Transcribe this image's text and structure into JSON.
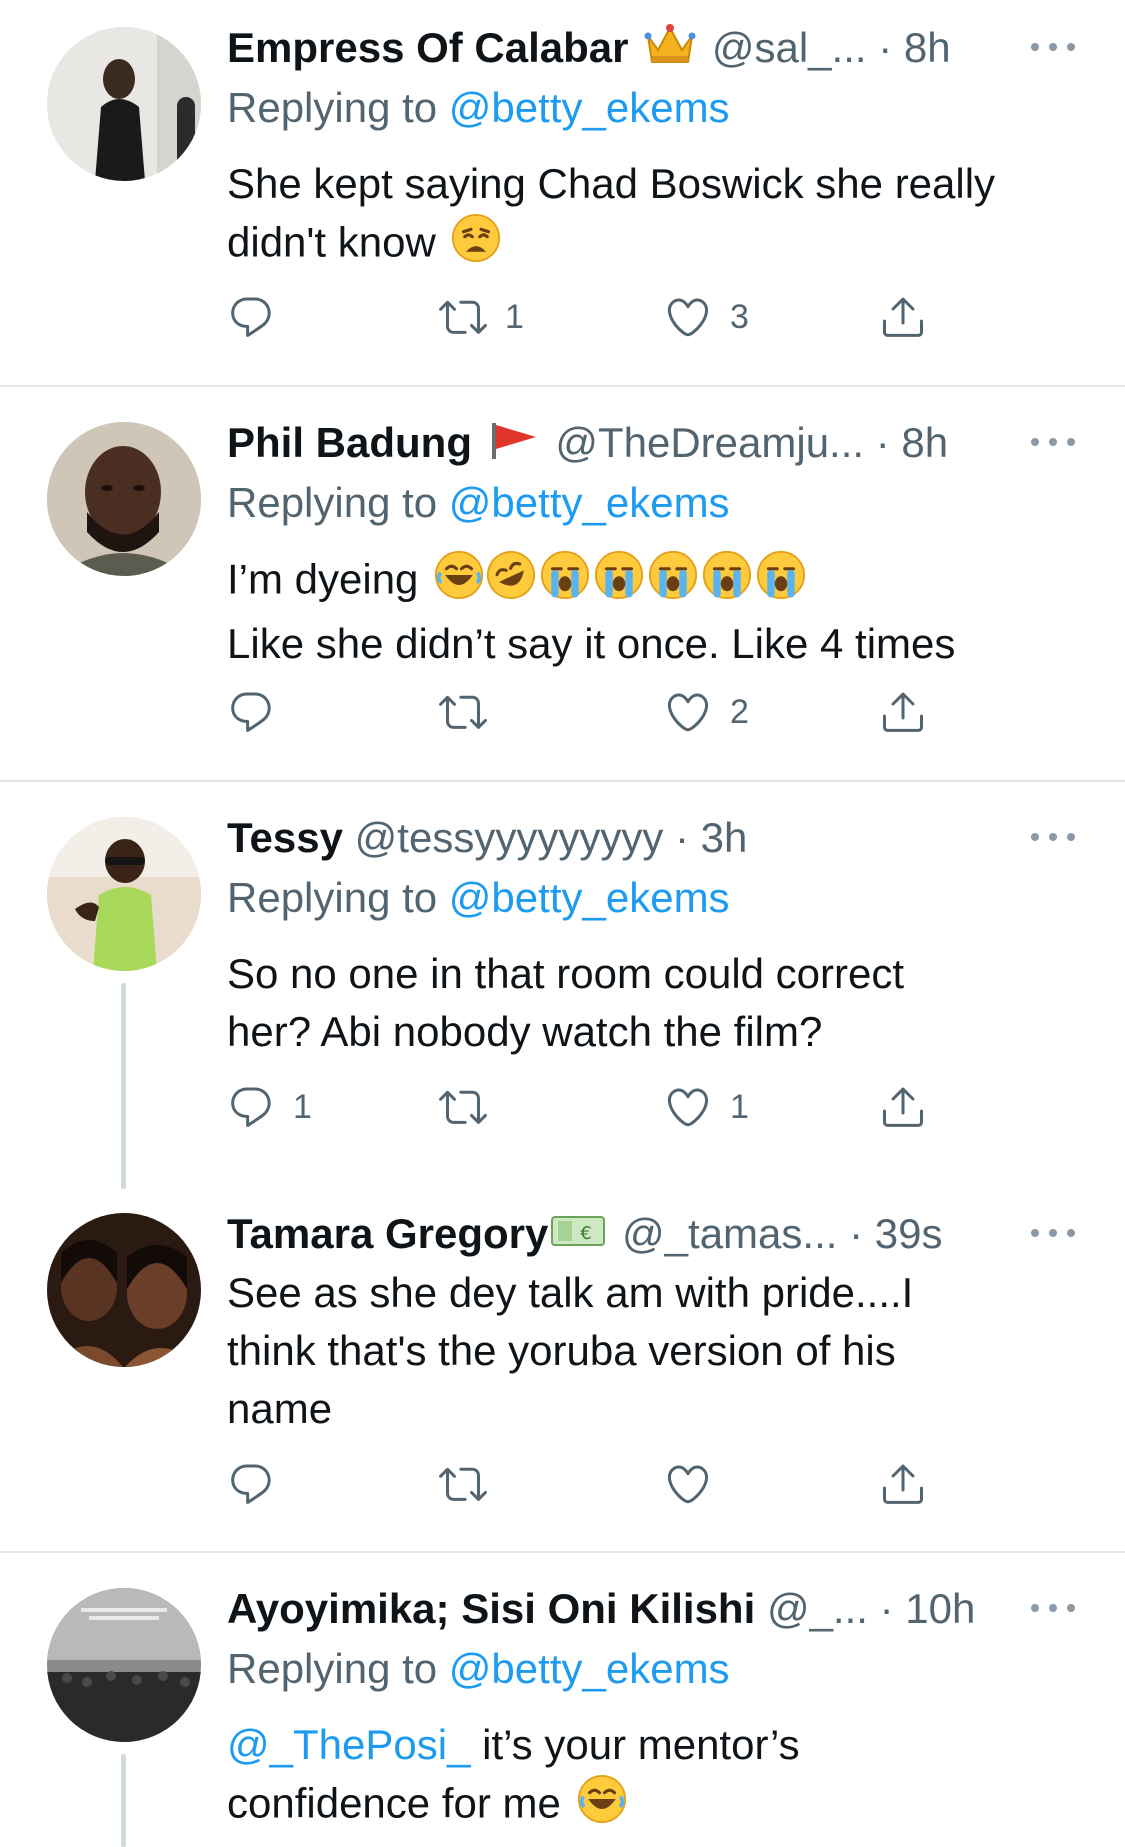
{
  "tweets": [
    {
      "name": "Empress Of Calabar",
      "badge": "crown",
      "handle": "@sal_...",
      "dot": "·",
      "time": "8h",
      "replying_label": "Replying to",
      "replying_handle": "@betty_ekems",
      "text_1": "She kept saying Chad Boswick she really",
      "text_2": "didn't know",
      "reply_count": "",
      "retweet_count": "1",
      "like_count": "3"
    },
    {
      "name": "Phil Badung",
      "badge": "red-flag",
      "handle": "@TheDreamju...",
      "dot": "·",
      "time": "8h",
      "replying_label": "Replying to",
      "replying_handle": "@betty_ekems",
      "text_1": "I’m dyeing",
      "text_2": "Like she didn’t say it once. Like 4 times",
      "reply_count": "",
      "retweet_count": "",
      "like_count": "2"
    },
    {
      "name": "Tessy",
      "handle": "@tessyyyyyyyyy",
      "dot": "·",
      "time": "3h",
      "replying_label": "Replying to",
      "replying_handle": "@betty_ekems",
      "text_1": "So no one in that room could correct",
      "text_2": "her? Abi nobody watch the film?",
      "reply_count": "1",
      "retweet_count": "",
      "like_count": "1"
    },
    {
      "name": "Tamara Gregory",
      "badge": "euro-banknote",
      "handle": "@_tamas...",
      "dot": "·",
      "time": "39s",
      "text_1": "See as she dey talk am with pride....I",
      "text_2": "think that's the yoruba version of his",
      "text_3": "name",
      "reply_count": "",
      "retweet_count": "",
      "like_count": ""
    },
    {
      "name": "Ayoyimika; Sisi Oni Kilishi",
      "handle": "@_...",
      "dot": "·",
      "time": "10h",
      "replying_label": "Replying to",
      "replying_handle": "@betty_ekems",
      "mention": "@_ThePosi_",
      "text_1": " it’s your mentor’s",
      "text_2": "confidence for me"
    }
  ],
  "colors": {
    "link": "#1d9bf0",
    "secondary_text": "#536471",
    "primary_text": "#0f1419",
    "divider": "#e3e6e8"
  },
  "icons": [
    "reply-icon",
    "retweet-icon",
    "like-icon",
    "share-icon",
    "more-icon"
  ]
}
